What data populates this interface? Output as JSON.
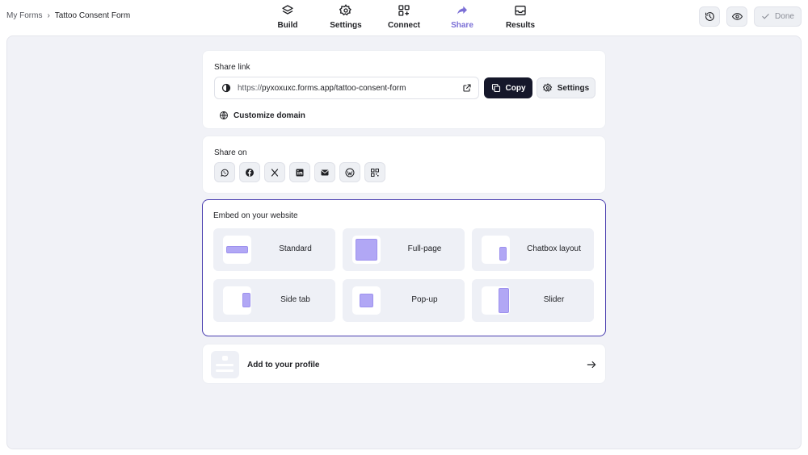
{
  "breadcrumb": {
    "parent": "My Forms",
    "separator": "›",
    "current": "Tattoo Consent Form"
  },
  "nav": {
    "build": "Build",
    "settings": "Settings",
    "connect": "Connect",
    "share": "Share",
    "results": "Results",
    "active": "Share"
  },
  "actions": {
    "done_label": "Done"
  },
  "share_link": {
    "title": "Share link",
    "url_protocol": "https://",
    "url_host": "pyxoxuxc.forms.app/tattoo-consent-form",
    "copy_label": "Copy",
    "settings_label": "Settings",
    "customize_label": "Customize domain"
  },
  "share_on": {
    "title": "Share on",
    "networks": [
      "whatsapp-icon",
      "facebook-icon",
      "x-icon",
      "linkedin-icon",
      "email-icon",
      "wordpress-icon",
      "qr-code-icon"
    ]
  },
  "embed": {
    "title": "Embed on your website",
    "options": [
      "Standard",
      "Full-page",
      "Chatbox layout",
      "Side tab",
      "Pop-up",
      "Slider"
    ]
  },
  "profile": {
    "label": "Add to your profile"
  },
  "colors": {
    "accent": "#7b6fd6",
    "embed_border": "#4a3fb0",
    "thumb_fill": "#b1a7f5",
    "primary_button": "#15172a"
  }
}
